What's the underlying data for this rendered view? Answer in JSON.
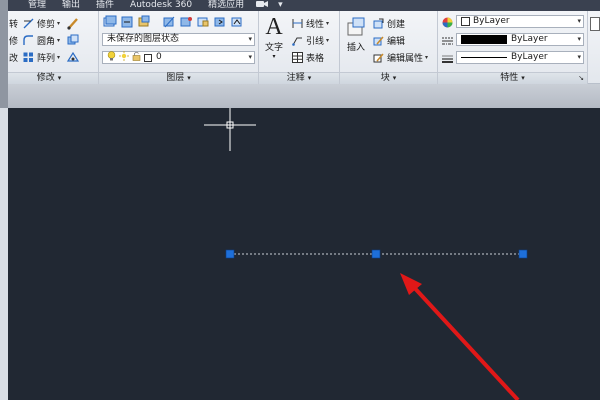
{
  "menubar": {
    "items": [
      "管理",
      "输出",
      "插件",
      "Autodesk 360",
      "精选应用"
    ],
    "extra": "▾"
  },
  "modify_panel": {
    "title": "修改",
    "left_chars": [
      "转",
      "修",
      "改"
    ],
    "tools": [
      "修剪",
      "圆角",
      "阵列"
    ]
  },
  "layers_panel": {
    "title": "图层",
    "state_combo": "未保存的图层状态",
    "layer_combo": "0"
  },
  "annotation_panel": {
    "title": "注释",
    "big_button": "文字",
    "tools": [
      "线性",
      "引线",
      "表格"
    ]
  },
  "block_panel": {
    "title": "块",
    "big_button": "插入",
    "tools": [
      "创建",
      "编辑",
      "编辑属性"
    ]
  },
  "properties_panel": {
    "title": "特性",
    "color_combo": "ByLayer",
    "linetype_combo": "ByLayer",
    "lineweight_combo": "ByLayer"
  },
  "colors": {
    "canvas": "#212833",
    "grip": "#1e6fd9",
    "arrow": "#e01818",
    "menubar": "#3a4150"
  }
}
